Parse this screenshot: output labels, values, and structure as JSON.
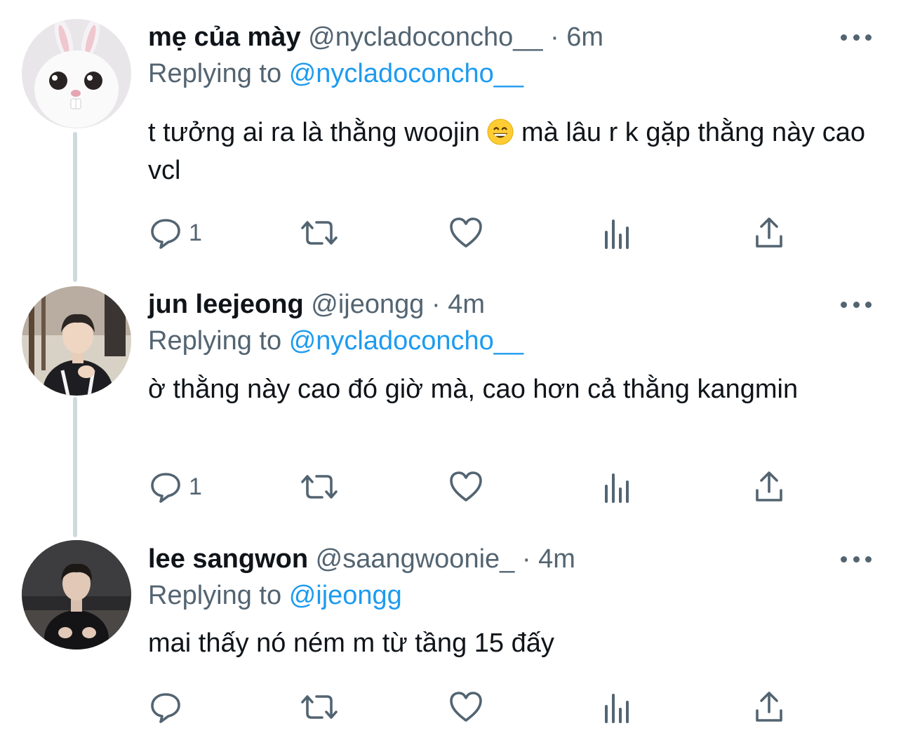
{
  "tweets": [
    {
      "name": "mẹ của mày",
      "handle": "@nycladoconcho__",
      "separator": "·",
      "time": "6m",
      "replying_prefix": "Replying to",
      "replying_to": "@nycladoconcho__",
      "text_before_emoji": "t tưởng ai ra là thằng woojin",
      "text_after_emoji": " mà lâu r k gặp thằng này cao vcl",
      "emoji": "grinning-face-emoji",
      "reply_count": "1",
      "avatar": "white-rabbit-avatar"
    },
    {
      "name": "jun leejeong",
      "handle": "@ijeongg",
      "separator": "·",
      "time": "4m",
      "replying_prefix": "Replying to",
      "replying_to": "@nycladoconcho__",
      "text": "ờ thằng này cao đó giờ mà, cao hơn cả thằng kangmin",
      "reply_count": "1",
      "avatar": "person-photo-avatar"
    },
    {
      "name": "lee sangwon",
      "handle": "@saangwoonie_",
      "separator": "·",
      "time": "4m",
      "replying_prefix": "Replying to",
      "replying_to": "@ijeongg",
      "text": "mai thấy nó ném m từ tầng 15 đấy",
      "reply_count": "",
      "avatar": "person-dark-photo-avatar"
    }
  ],
  "colors": {
    "accent": "#1d9bf0",
    "secondary": "#536471",
    "primary": "#0f1419",
    "thread_line": "#cfd9de"
  },
  "icons": [
    "reply-icon",
    "retweet-icon",
    "like-icon",
    "views-icon",
    "share-icon",
    "more-icon"
  ]
}
